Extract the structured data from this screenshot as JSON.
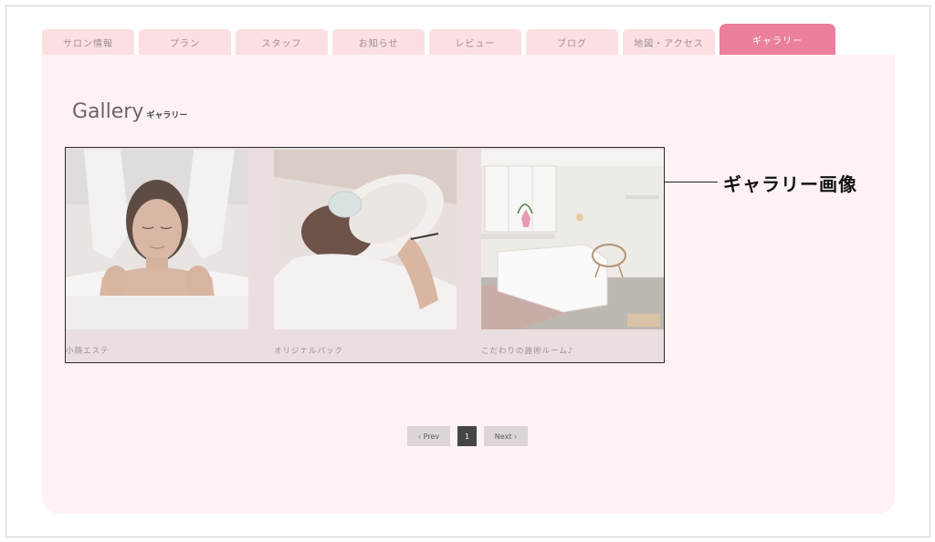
{
  "tabs": [
    {
      "label": "サロン情報"
    },
    {
      "label": "プラン"
    },
    {
      "label": "スタッフ"
    },
    {
      "label": "お知らせ"
    },
    {
      "label": "レビュー"
    },
    {
      "label": "ブログ"
    },
    {
      "label": "地図・アクセス"
    },
    {
      "label": "ギャラリー",
      "active": true
    }
  ],
  "heading": {
    "en": "Gallery",
    "ja": "ギャラリー"
  },
  "gallery": {
    "items": [
      {
        "caption": "小顔エステ"
      },
      {
        "caption": "オリジナルパック"
      },
      {
        "caption": "こだわりの施術ルーム♪"
      }
    ]
  },
  "annotation": {
    "label": "ギャラリー画像"
  },
  "pagination": {
    "prev": "‹ Prev",
    "page": "1",
    "next": "Next ›"
  },
  "colors": {
    "tab": "#fbdfe2",
    "tab_active": "#ec7f9b",
    "panel": "#fff2f2"
  }
}
